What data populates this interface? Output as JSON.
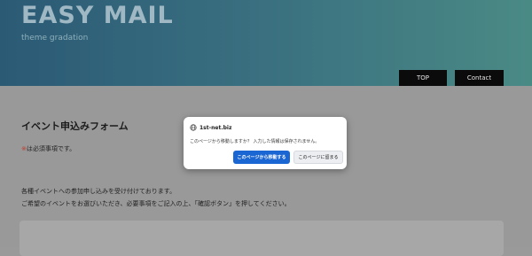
{
  "header": {
    "site_title": "EASY MAIL",
    "site_subtitle": "theme gradation",
    "nav": [
      {
        "label": "TOP"
      },
      {
        "label": "Contact"
      }
    ]
  },
  "main": {
    "page_title": "イベント申込みフォーム",
    "required_mark": "※",
    "required_text": "は必須事項です。",
    "intro_line1": "各種イベントへの参加申し込みを受け付けております。",
    "intro_line2": "ご希望のイベントをお選びいただき、必要事項をご記入の上、「確認ボタン」を押してください。"
  },
  "dialog": {
    "host": "1st-net.biz",
    "message": "このページから移動しますか？ 入力した情報は保存されません。",
    "leave_label": "このページから移動する",
    "stay_label": "このページに留まる"
  },
  "colors": {
    "header_gradient_start": "#2b5a75",
    "header_gradient_end": "#4a8a85",
    "primary_button": "#1a66d2",
    "required_mark": "#c0392b"
  }
}
